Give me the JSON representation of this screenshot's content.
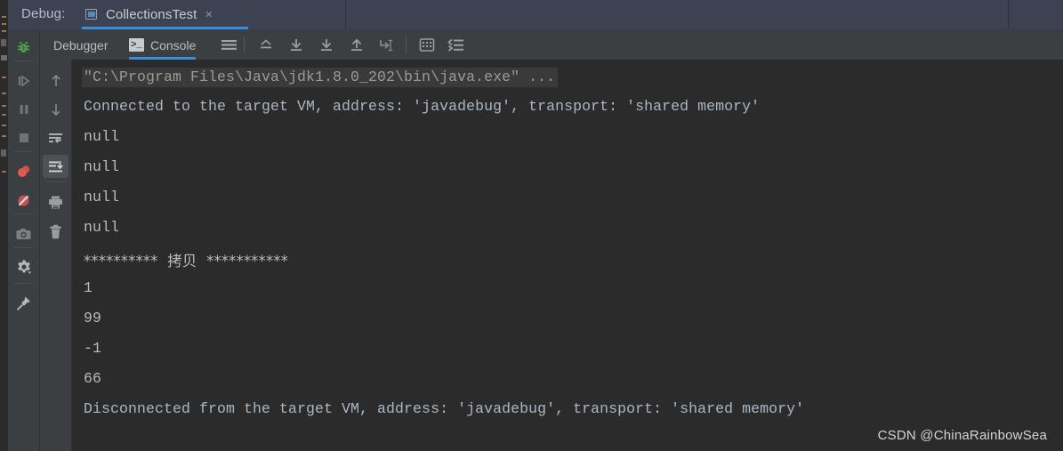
{
  "window": {
    "title_label": "Debug:",
    "tab": {
      "name": "CollectionsTest",
      "icon": "application-run-icon",
      "close_icon": "×"
    }
  },
  "panel_toolbar": {
    "tabs": [
      {
        "label": "Debugger",
        "icon": "",
        "selected": false
      },
      {
        "label": "Console",
        "icon": "console-glyph-icon",
        "glyph": ">_",
        "selected": true
      }
    ],
    "buttons": [
      {
        "name": "soft-wrap-icon"
      },
      {
        "name": "scroll-to-top-icon"
      },
      {
        "name": "scroll-to-end-icon"
      },
      {
        "name": "scroll-down-icon"
      },
      {
        "name": "scroll-up-icon"
      },
      {
        "name": "go-to-cursor-icon"
      },
      {
        "name": "use-soft-wraps-icon"
      },
      {
        "name": "print-layout-icon"
      }
    ]
  },
  "left_rail_primary": [
    {
      "name": "debug-bug-icon",
      "color": "#4f9e4f"
    },
    {
      "name": "resume-program-icon"
    },
    {
      "name": "pause-program-icon"
    },
    {
      "name": "stop-program-icon"
    },
    {
      "name": "view-breakpoints-icon",
      "color": "#db5c5c"
    },
    {
      "name": "mute-breakpoints-icon",
      "color": "#c94f4f"
    },
    {
      "name": "screenshot-icon"
    },
    {
      "name": "settings-gear-icon"
    },
    {
      "name": "pin-tab-icon"
    }
  ],
  "left_rail_secondary": [
    {
      "name": "step-up-icon"
    },
    {
      "name": "step-down-icon"
    },
    {
      "name": "soft-wrap-lines-icon"
    },
    {
      "name": "scroll-to-end-icon",
      "selected": true
    },
    {
      "name": "print-icon"
    },
    {
      "name": "clear-all-icon"
    }
  ],
  "console": {
    "lines": [
      {
        "type": "cmd",
        "text": "\"C:\\Program Files\\Java\\jdk1.8.0_202\\bin\\java.exe\" ..."
      },
      {
        "type": "sys",
        "text": "Connected to the target VM, address: 'javadebug', transport: 'shared memory'"
      },
      {
        "type": "out",
        "text": "null"
      },
      {
        "type": "out",
        "text": "null"
      },
      {
        "type": "out",
        "text": "null"
      },
      {
        "type": "out",
        "text": "null"
      },
      {
        "type": "cjk",
        "text": "**********  拷贝  ***********"
      },
      {
        "type": "out",
        "text": "1"
      },
      {
        "type": "out",
        "text": "99"
      },
      {
        "type": "out",
        "text": "-1"
      },
      {
        "type": "out",
        "text": "66"
      },
      {
        "type": "sys",
        "text": "Disconnected from the target VM, address: 'javadebug', transport: 'shared memory'"
      }
    ],
    "watermark": "CSDN @ChinaRainbowSea"
  },
  "colors": {
    "accent_blue": "#4a88c7",
    "titlebar_bg": "#3c4251",
    "chrome_bg": "#3c3f41",
    "console_bg": "#2b2b2b",
    "sys_text": "#a9b7c6",
    "out_text": "#bbbbbb",
    "cmd_text": "#9a9a9a"
  }
}
